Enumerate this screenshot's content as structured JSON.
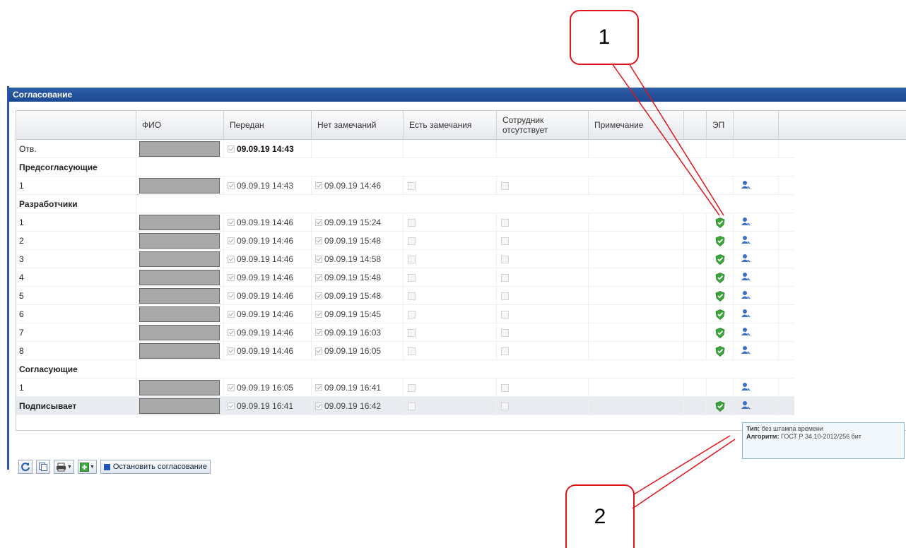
{
  "callouts": {
    "one": "1",
    "two": "2"
  },
  "panel": {
    "title": "Согласование"
  },
  "columns": {
    "fio": "ФИО",
    "sent": "Передан",
    "no_remarks": "Нет замечаний",
    "has_remarks": "Есть замечания",
    "absent": "Сотрудник отсутствует",
    "note": "Примечание",
    "ep": "ЭП"
  },
  "rows": [
    {
      "label": "Отв.",
      "type": "data",
      "sent": "09.09.19 14:43",
      "no_remarks": "",
      "boxes": false,
      "ep": false,
      "user": false
    },
    {
      "label": "Предсогласующие",
      "type": "group"
    },
    {
      "label": "1",
      "type": "data",
      "sent": "09.09.19 14:43",
      "no_remarks": "09.09.19 14:46",
      "boxes": true,
      "ep": false,
      "user": true
    },
    {
      "label": "Разработчики",
      "type": "group"
    },
    {
      "label": "1",
      "type": "data",
      "sent": "09.09.19 14:46",
      "no_remarks": "09.09.19 15:24",
      "boxes": true,
      "ep": true,
      "user": true
    },
    {
      "label": "2",
      "type": "data",
      "sent": "09.09.19 14:46",
      "no_remarks": "09.09.19 15:48",
      "boxes": true,
      "ep": true,
      "user": true
    },
    {
      "label": "3",
      "type": "data",
      "sent": "09.09.19 14:46",
      "no_remarks": "09.09.19 14:58",
      "boxes": true,
      "ep": true,
      "user": true
    },
    {
      "label": "4",
      "type": "data",
      "sent": "09.09.19 14:46",
      "no_remarks": "09.09.19 15:48",
      "boxes": true,
      "ep": true,
      "user": true
    },
    {
      "label": "5",
      "type": "data",
      "sent": "09.09.19 14:46",
      "no_remarks": "09.09.19 15:48",
      "boxes": true,
      "ep": true,
      "user": true
    },
    {
      "label": "6",
      "type": "data",
      "sent": "09.09.19 14:46",
      "no_remarks": "09.09.19 15:45",
      "boxes": true,
      "ep": true,
      "user": true
    },
    {
      "label": "7",
      "type": "data",
      "sent": "09.09.19 14:46",
      "no_remarks": "09.09.19 16:03",
      "boxes": true,
      "ep": true,
      "user": true
    },
    {
      "label": "8",
      "type": "data",
      "sent": "09.09.19 14:46",
      "no_remarks": "09.09.19 16:05",
      "boxes": true,
      "ep": true,
      "user": true
    },
    {
      "label": "Согласующие",
      "type": "group"
    },
    {
      "label": "1",
      "type": "data",
      "sent": "09.09.19 16:05",
      "no_remarks": "09.09.19 16:41",
      "boxes": true,
      "ep": false,
      "user": true
    },
    {
      "label": "Подписывает",
      "type": "data",
      "bold": true,
      "shaded": true,
      "sent": "09.09.19 16:41",
      "no_remarks": "09.09.19 16:42",
      "boxes": true,
      "ep": true,
      "user": true
    }
  ],
  "toolbar": {
    "stop_label": "Остановить согласование"
  },
  "tooltip": {
    "type_label": "Тип:",
    "type_value": "без штампа времени",
    "algo_label": "Алгоритм:",
    "algo_value": "ГОСТ Р 34.10-2012/256 бит"
  },
  "colors": {
    "title_bar": "#1f4c96",
    "callout_border": "#e0141b",
    "ep_green": "#3aa63a",
    "user_blue": "#3b6fc4"
  }
}
